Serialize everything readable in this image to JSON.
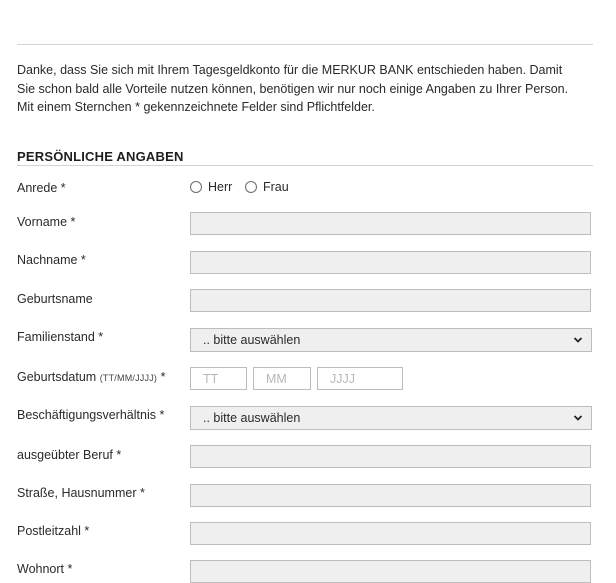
{
  "intro": {
    "line1": "Danke, dass Sie sich mit Ihrem Tagesgeldkonto für die MERKUR BANK entschieden haben. Damit",
    "line2": "Sie schon bald alle Vorteile nutzen können, benötigen wir nur noch einige Angaben zu Ihrer Person.",
    "line3": "Mit einem Sternchen * gekennzeichnete Felder sind Pflichtfelder."
  },
  "section": {
    "title": "PERSÖNLICHE ANGABEN"
  },
  "form": {
    "anrede": {
      "label": "Anrede *",
      "options": [
        "Herr",
        "Frau"
      ]
    },
    "vorname": {
      "label": "Vorname *",
      "value": ""
    },
    "nachname": {
      "label": "Nachname *",
      "value": ""
    },
    "geburtsname": {
      "label": "Geburtsname",
      "value": ""
    },
    "familienstand": {
      "label": "Familienstand *",
      "selected": ".. bitte auswählen"
    },
    "geburtsdatum": {
      "label": "Geburtsdatum",
      "hint": "(TT/MM/JJJJ)",
      "required_mark": " *",
      "placeholders": {
        "day": "TT",
        "month": "MM",
        "year": "JJJJ"
      }
    },
    "beschaeftigung": {
      "label": "Beschäftigungsverhältnis *",
      "selected": ".. bitte auswählen"
    },
    "beruf": {
      "label": "ausgeübter Beruf *",
      "value": ""
    },
    "strasse": {
      "label": "Straße, Hausnummer *",
      "value": ""
    },
    "plz": {
      "label": "Postleitzahl *",
      "value": ""
    },
    "wohnort": {
      "label": "Wohnort *",
      "value": ""
    }
  },
  "icons": {
    "radio": "radio-circle-icon",
    "select": "chevron-down-icon"
  }
}
